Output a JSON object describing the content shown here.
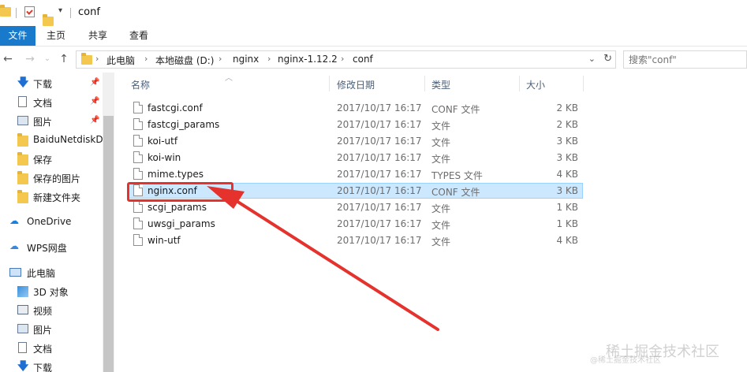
{
  "window": {
    "title": "conf",
    "quick_access_icons": [
      "folder-icon",
      "properties-icon",
      "new-folder-icon",
      "customize-arrow-icon"
    ]
  },
  "ribbon": {
    "tabs": [
      {
        "label": "文件",
        "active": true
      },
      {
        "label": "主页",
        "active": false
      },
      {
        "label": "共享",
        "active": false
      },
      {
        "label": "查看",
        "active": false
      }
    ]
  },
  "address": {
    "crumbs": [
      "此电脑",
      "本地磁盘 (D:)",
      "nginx",
      "nginx-1.12.2",
      "conf"
    ],
    "search_placeholder": "搜索\"conf\""
  },
  "sidebar": {
    "items": [
      {
        "label": "下载",
        "icon": "download-icon",
        "pinned": true
      },
      {
        "label": "文档",
        "icon": "document-icon",
        "pinned": true
      },
      {
        "label": "图片",
        "icon": "pictures-icon",
        "pinned": true
      },
      {
        "label": "BaiduNetdiskD",
        "icon": "folder-icon",
        "pinned": false
      },
      {
        "label": "保存",
        "icon": "folder-icon",
        "pinned": false
      },
      {
        "label": "保存的图片",
        "icon": "folder-icon",
        "pinned": false
      },
      {
        "label": "新建文件夹",
        "icon": "folder-icon",
        "pinned": false
      },
      {
        "label": "OneDrive",
        "icon": "onedrive-cloud-icon",
        "pinned": false
      },
      {
        "label": "WPS网盘",
        "icon": "wps-cloud-icon",
        "pinned": false
      },
      {
        "label": "此电脑",
        "icon": "computer-icon",
        "pinned": false
      },
      {
        "label": "3D 对象",
        "icon": "3d-objects-icon",
        "pinned": false
      },
      {
        "label": "视频",
        "icon": "video-icon",
        "pinned": false
      },
      {
        "label": "图片",
        "icon": "pictures-icon",
        "pinned": false
      },
      {
        "label": "文档",
        "icon": "document-icon",
        "pinned": false
      },
      {
        "label": "下载",
        "icon": "download-icon",
        "pinned": false
      }
    ]
  },
  "columns": {
    "name": "名称",
    "date": "修改日期",
    "type": "类型",
    "size": "大小"
  },
  "files": [
    {
      "name": "fastcgi.conf",
      "date": "2017/10/17 16:17",
      "type": "CONF 文件",
      "size": "2 KB",
      "selected": false
    },
    {
      "name": "fastcgi_params",
      "date": "2017/10/17 16:17",
      "type": "文件",
      "size": "2 KB",
      "selected": false
    },
    {
      "name": "koi-utf",
      "date": "2017/10/17 16:17",
      "type": "文件",
      "size": "3 KB",
      "selected": false
    },
    {
      "name": "koi-win",
      "date": "2017/10/17 16:17",
      "type": "文件",
      "size": "3 KB",
      "selected": false
    },
    {
      "name": "mime.types",
      "date": "2017/10/17 16:17",
      "type": "TYPES 文件",
      "size": "4 KB",
      "selected": false
    },
    {
      "name": "nginx.conf",
      "date": "2017/10/17 16:17",
      "type": "CONF 文件",
      "size": "3 KB",
      "selected": true
    },
    {
      "name": "scgi_params",
      "date": "2017/10/17 16:17",
      "type": "文件",
      "size": "1 KB",
      "selected": false
    },
    {
      "name": "uwsgi_params",
      "date": "2017/10/17 16:17",
      "type": "文件",
      "size": "1 KB",
      "selected": false
    },
    {
      "name": "win-utf",
      "date": "2017/10/17 16:17",
      "type": "文件",
      "size": "4 KB",
      "selected": false
    }
  ],
  "annotation": {
    "color": "#e5322d"
  },
  "watermark": {
    "text": "稀土掘金技术社区",
    "small": "@稀土掘金技术社区"
  },
  "colors": {
    "accent": "#1979ca",
    "selection_bg": "#cce8ff",
    "selection_border": "#99d1ff"
  }
}
